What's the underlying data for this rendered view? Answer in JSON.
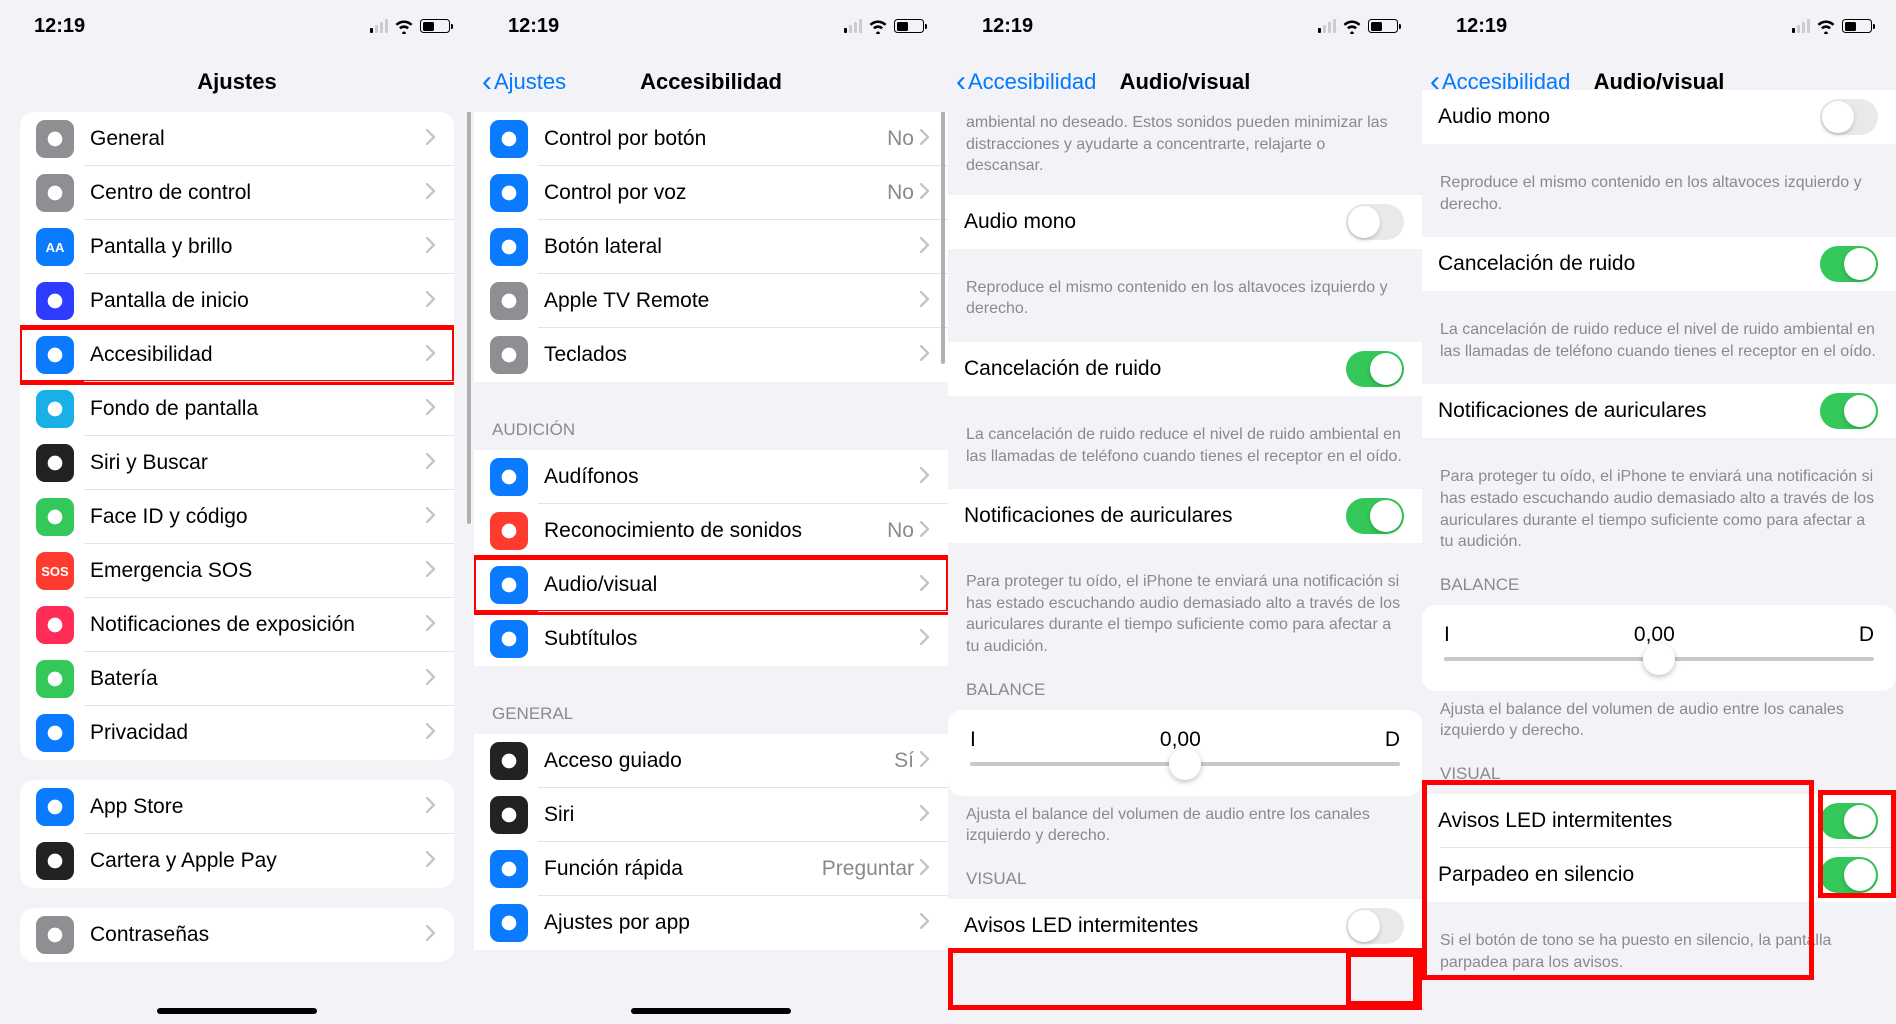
{
  "time": "12:19",
  "screen1": {
    "title": "Ajustes",
    "rows": [
      "General",
      "Centro de control",
      "Pantalla y brillo",
      "Pantalla de inicio",
      "Accesibilidad",
      "Fondo de pantalla",
      "Siri y Buscar",
      "Face ID y código",
      "Emergencia SOS",
      "Notificaciones de exposición",
      "Batería",
      "Privacidad"
    ],
    "rows2": [
      "App Store",
      "Cartera y Apple Pay"
    ],
    "rows3": [
      "Contraseñas"
    ]
  },
  "screen2": {
    "back": "Ajustes",
    "title": "Accesibilidad",
    "physical": [
      {
        "label": "Control por botón",
        "value": "No"
      },
      {
        "label": "Control por voz",
        "value": "No"
      },
      {
        "label": "Botón lateral"
      },
      {
        "label": "Apple TV Remote"
      },
      {
        "label": "Teclados"
      }
    ],
    "hearing_header": "AUDICIÓN",
    "hearing": [
      {
        "label": "Audífonos"
      },
      {
        "label": "Reconocimiento de sonidos",
        "value": "No"
      },
      {
        "label": "Audio/visual"
      },
      {
        "label": "Subtítulos"
      }
    ],
    "general_header": "GENERAL",
    "general": [
      {
        "label": "Acceso guiado",
        "value": "Sí"
      },
      {
        "label": "Siri"
      },
      {
        "label": "Función rápida",
        "value": "Preguntar"
      },
      {
        "label": "Ajustes por app"
      }
    ]
  },
  "screen3": {
    "back": "Accesibilidad",
    "title": "Audio/visual",
    "intro": "ambiental no deseado. Estos sonidos pueden minimizar las distracciones y ayudarte a concentrarte, relajarte o descansar.",
    "mono_label": "Audio mono",
    "mono_footer": "Reproduce el mismo contenido en los altavoces izquierdo y derecho.",
    "noise_label": "Cancelación de ruido",
    "noise_footer": "La cancelación de ruido reduce el nivel de ruido ambiental en las llamadas de teléfono cuando tienes el receptor en el oído.",
    "headphone_label": "Notificaciones de auriculares",
    "headphone_footer": "Para proteger tu oído, el iPhone te enviará una notificación si has estado escuchando audio demasiado alto a través de los auriculares durante el tiempo suficiente como para afectar a tu audición.",
    "balance_header": "BALANCE",
    "balance_left": "I",
    "balance_value": "0,00",
    "balance_right": "D",
    "balance_footer": "Ajusta el balance del volumen de audio entre los canales izquierdo y derecho.",
    "visual_header": "VISUAL",
    "led_label": "Avisos LED intermitentes"
  },
  "screen4": {
    "back": "Accesibilidad",
    "title": "Audio/visual",
    "mono_label": "Audio mono",
    "mono_footer": "Reproduce el mismo contenido en los altavoces izquierdo y derecho.",
    "noise_label": "Cancelación de ruido",
    "noise_footer": "La cancelación de ruido reduce el nivel de ruido ambiental en las llamadas de teléfono cuando tienes el receptor en el oído.",
    "headphone_label": "Notificaciones de auriculares",
    "headphone_footer": "Para proteger tu oído, el iPhone te enviará una notificación si has estado escuchando audio demasiado alto a través de los auriculares durante el tiempo suficiente como para afectar a tu audición.",
    "balance_header": "BALANCE",
    "balance_left": "I",
    "balance_value": "0,00",
    "balance_right": "D",
    "balance_footer": "Ajusta el balance del volumen de audio entre los canales izquierdo y derecho.",
    "visual_header": "VISUAL",
    "led_label": "Avisos LED intermitentes",
    "silent_label": "Parpadeo en silencio",
    "led_footer": "Si el botón de tono se ha puesto en silencio, la pantalla parpadea para los avisos."
  },
  "icon_colors": {
    "general": "#8e8e93",
    "control": "#8e8e93",
    "display": "#0a7aff",
    "home": "#2e3cff",
    "accessibility": "#0a7aff",
    "wallpaper": "#17b1e7",
    "siri": "#222",
    "faceid": "#34c759",
    "sos": "#ff3b30",
    "exposure": "#ff2d55",
    "battery": "#34c759",
    "privacy": "#0a7aff",
    "appstore": "#0a7aff",
    "wallet": "#222",
    "passwords": "#8e8e93",
    "switch": "#0a7aff",
    "voice": "#0a7aff",
    "side": "#0a7aff",
    "tv": "#8e8e93",
    "keyboard": "#8e8e93",
    "hearing": "#0a7aff",
    "sound": "#ff3b30",
    "av": "#0a7aff",
    "cc": "#0a7aff",
    "guided": "#222",
    "fsiri": "#222",
    "shortcut": "#0a7aff",
    "perapp": "#0a7aff"
  }
}
